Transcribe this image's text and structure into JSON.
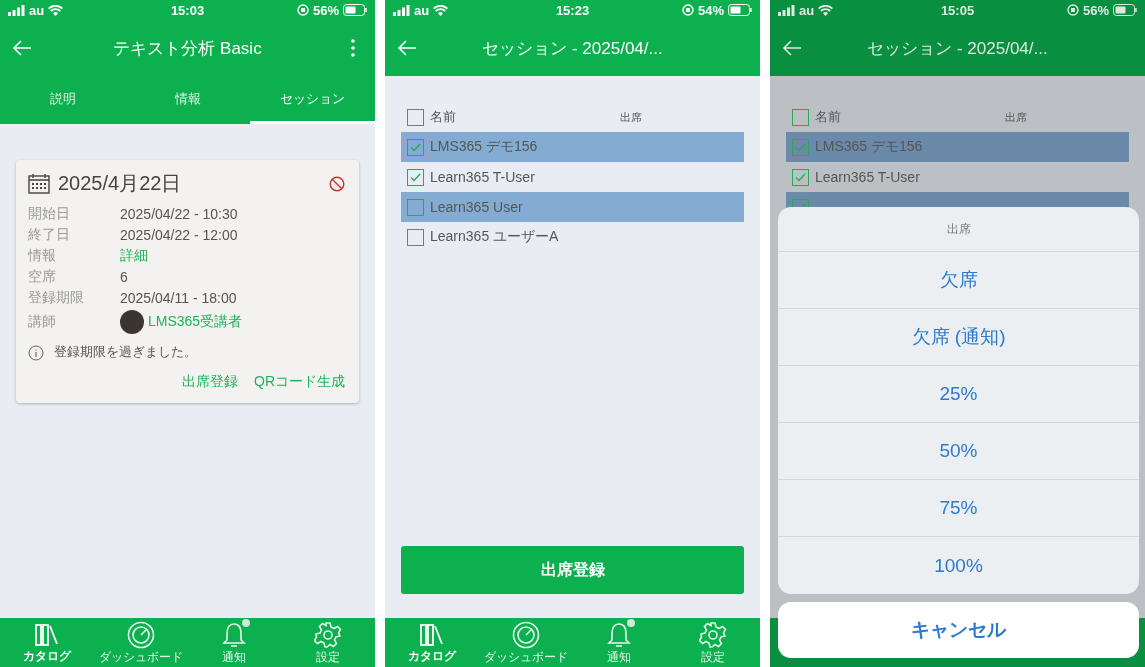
{
  "screens": [
    {
      "kind": "detail",
      "dimmed": false,
      "status": {
        "carrier": "au",
        "time": "15:03",
        "battery": "56%"
      },
      "header": {
        "title": "テキスト分析 Basic",
        "menu": true
      },
      "tabs": [
        {
          "label": "説明",
          "selected": false
        },
        {
          "label": "情報",
          "selected": false
        },
        {
          "label": "セッション",
          "selected": true
        }
      ],
      "card": {
        "date": "2025/4月22日",
        "rows": [
          {
            "kind": "text",
            "label": "開始日",
            "value": "2025/04/22 - 10:30"
          },
          {
            "kind": "text",
            "label": "終了日",
            "value": "2025/04/22 - 12:00"
          },
          {
            "kind": "link",
            "label": "情報",
            "value": "詳細"
          },
          {
            "kind": "text",
            "label": "空席",
            "value": "6"
          },
          {
            "kind": "text",
            "label": "登録期限",
            "value": "2025/04/11 - 18:00"
          },
          {
            "kind": "person",
            "label": "講師",
            "value": "LMS365受講者"
          }
        ],
        "note": "登録期限を過ぎました。",
        "actions": [
          "出席登録",
          "QRコード生成"
        ]
      },
      "tabbar": [
        {
          "label": "カタログ",
          "selected": true,
          "badge": false
        },
        {
          "label": "ダッシュボード",
          "selected": false,
          "badge": false
        },
        {
          "label": "通知",
          "selected": false,
          "badge": true
        },
        {
          "label": "設定",
          "selected": false,
          "badge": false
        }
      ]
    },
    {
      "kind": "attendance",
      "dimmed": false,
      "status": {
        "carrier": "au",
        "time": "15:23",
        "battery": "54%"
      },
      "header": {
        "title": "セッション - 2025/04/...",
        "menu": false
      },
      "list": {
        "name_heading": "名前",
        "attendance_heading": "出席",
        "all_checked": false,
        "rows": [
          {
            "name": "LMS365 デモ156",
            "checked": true,
            "selected": true
          },
          {
            "name": "Learn365 T-User",
            "checked": true,
            "selected": false
          },
          {
            "name": "Learn365 User",
            "checked": false,
            "selected": true
          },
          {
            "name": "Learn365 ユーザーA",
            "checked": false,
            "selected": false
          }
        ]
      },
      "button": "出席登録",
      "tabbar": [
        {
          "label": "カタログ",
          "selected": true,
          "badge": false
        },
        {
          "label": "ダッシュボード",
          "selected": false,
          "badge": false
        },
        {
          "label": "通知",
          "selected": false,
          "badge": true
        },
        {
          "label": "設定",
          "selected": false,
          "badge": false
        }
      ]
    },
    {
      "kind": "attendance",
      "dimmed": true,
      "status": {
        "carrier": "au",
        "time": "15:05",
        "battery": "56%"
      },
      "header": {
        "title": "セッション - 2025/04/...",
        "menu": false
      },
      "list": {
        "name_heading": "名前",
        "attendance_heading": "出席",
        "all_checked": false,
        "rows": [
          {
            "name": "LMS365 デモ156",
            "checked": true,
            "selected": true
          },
          {
            "name": "Learn365 T-User",
            "checked": true,
            "selected": false
          },
          {
            "checked": true,
            "selected": true
          }
        ]
      },
      "sheet": {
        "title": "出席",
        "options": [
          "欠席",
          "欠席 (通知)",
          "25%",
          "50%",
          "75%",
          "100%"
        ],
        "cancel": "キャンセル"
      }
    }
  ]
}
